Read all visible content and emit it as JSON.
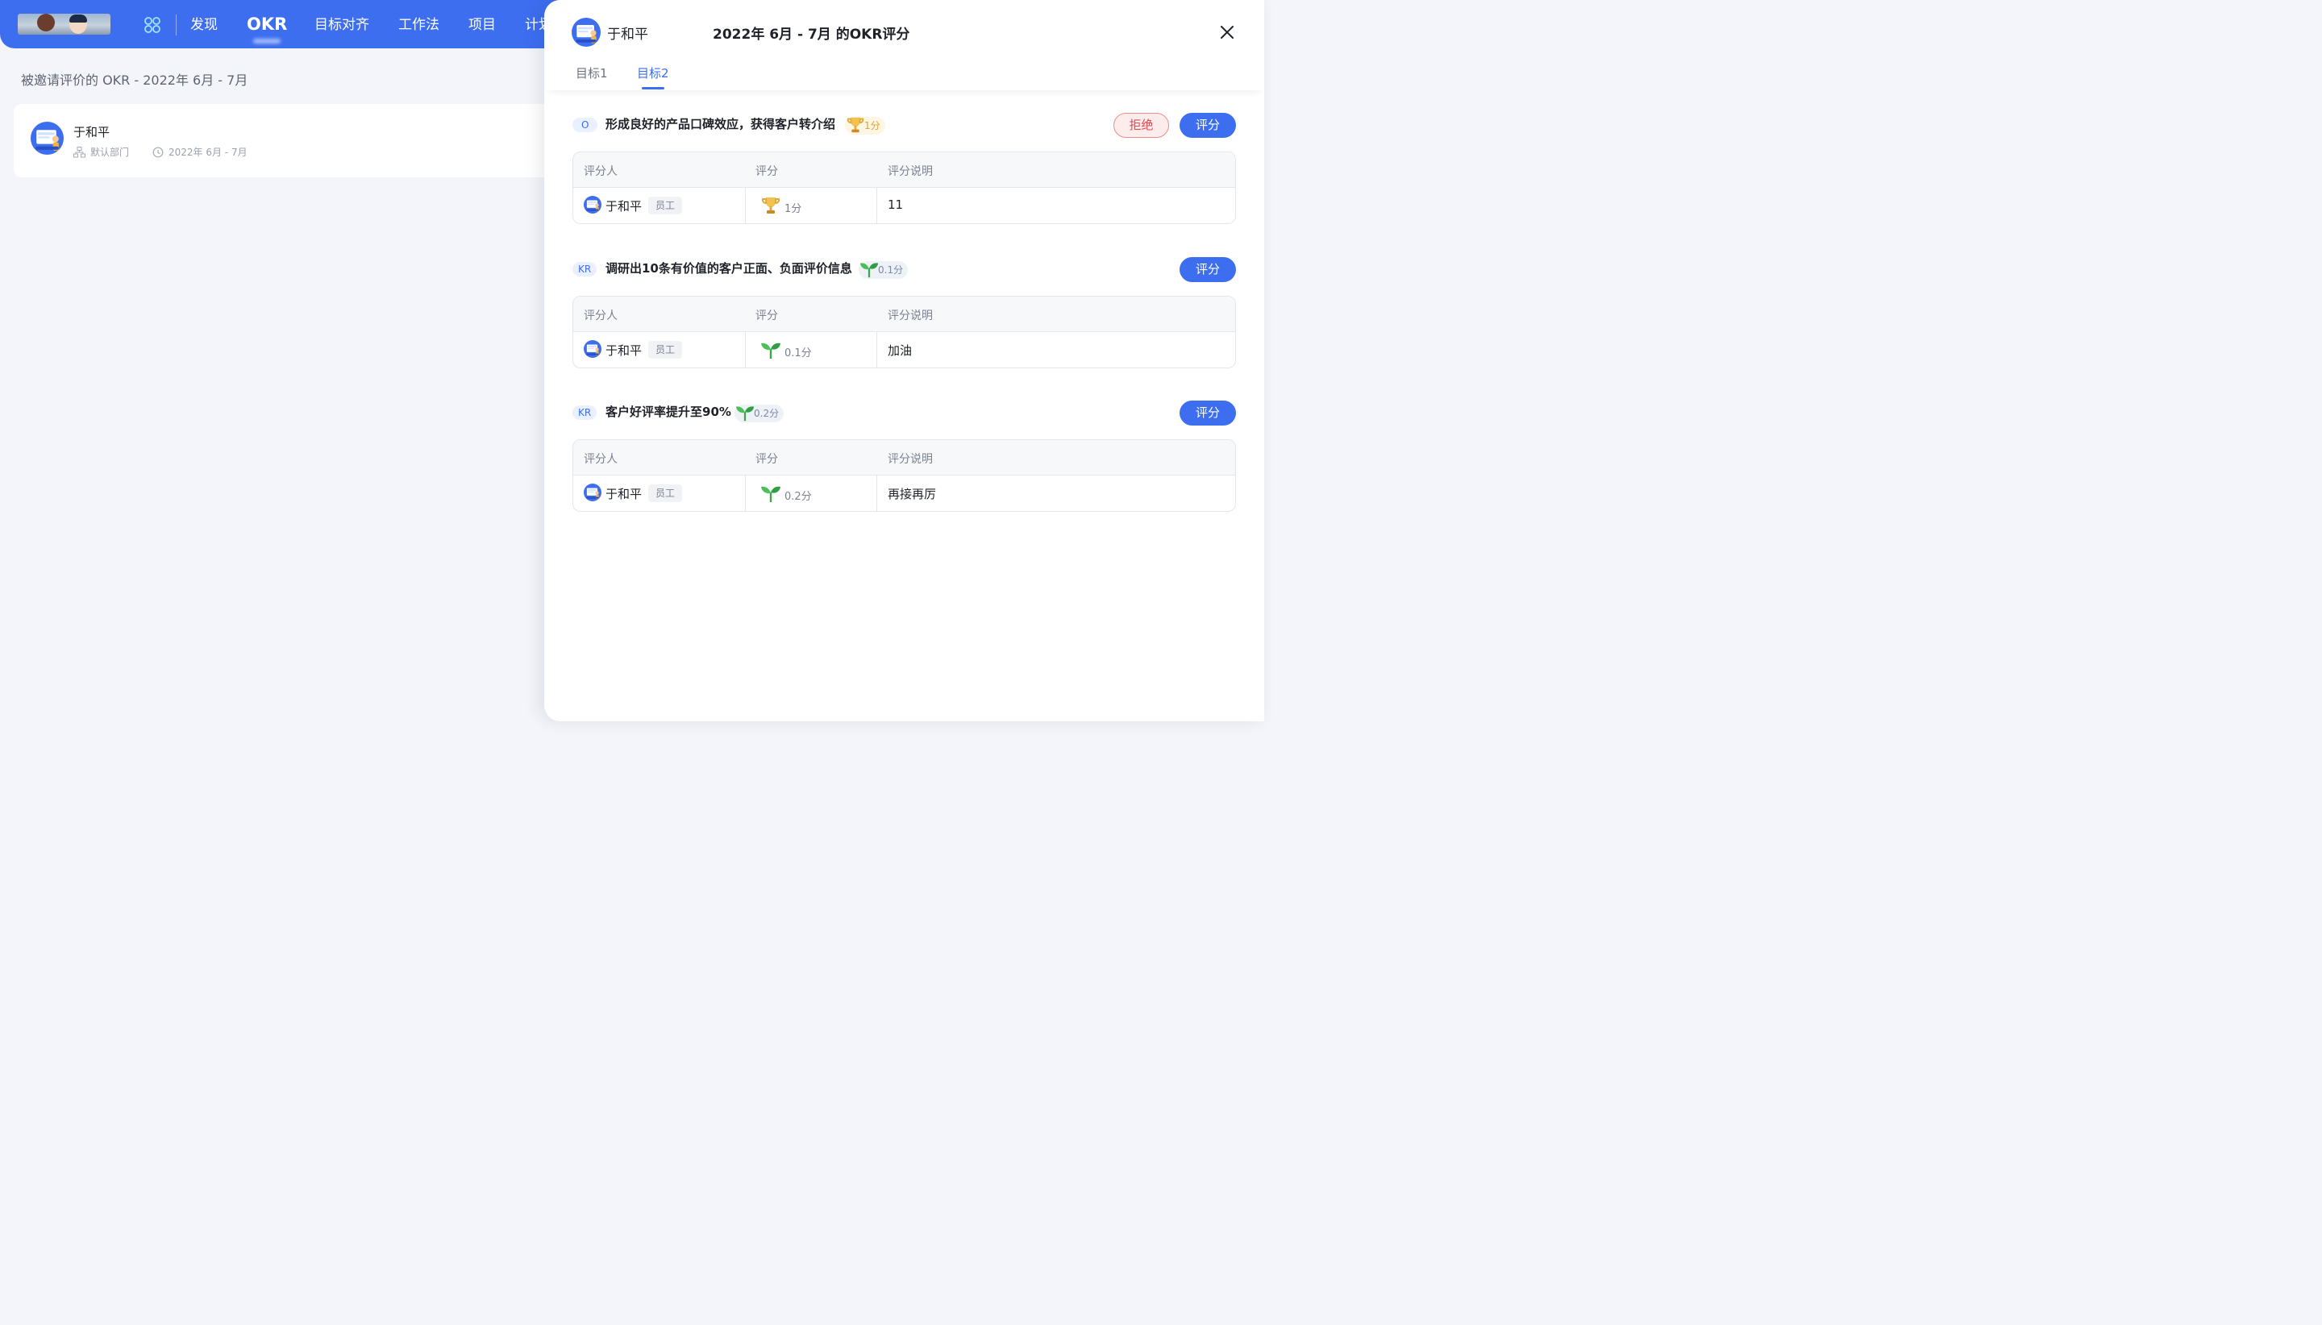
{
  "nav": {
    "items": [
      "发现",
      "OKR",
      "目标对齐",
      "工作法",
      "项目",
      "计划"
    ],
    "active": "OKR"
  },
  "page": {
    "title": "被邀请评价的 OKR - 2022年 6月 - 7月",
    "card": {
      "name": "于和平",
      "department": "默认部门",
      "period": "2022年 6月 - 7月"
    }
  },
  "drawer": {
    "user": "于和平",
    "title": "2022年 6月 - 7月 的OKR评分",
    "tabs": [
      "目标1",
      "目标2"
    ],
    "active_tab": "目标2",
    "table_headers": {
      "rater": "评分人",
      "score": "评分",
      "comment": "评分说明"
    },
    "sections": [
      {
        "tag": "O",
        "text": "形成良好的产品口碑效应，获得客户转介绍",
        "score_badge": "1分",
        "badge_icon": "trophy-icon",
        "has_reject": true,
        "reject_label": "拒绝",
        "score_label": "评分",
        "row": {
          "rater": "于和平",
          "role": "员工",
          "score": "1分",
          "icon": "trophy-icon",
          "comment": "11"
        }
      },
      {
        "tag": "KR",
        "text": "调研出10条有价值的客户正面、负面评价信息",
        "score_badge": "0.1分",
        "badge_icon": "sprout-icon",
        "has_reject": false,
        "score_label": "评分",
        "row": {
          "rater": "于和平",
          "role": "员工",
          "score": "0.1分",
          "icon": "sprout-icon",
          "comment": "加油"
        }
      },
      {
        "tag": "KR",
        "text": "客户好评率提升至90%",
        "score_badge": "0.2分",
        "badge_icon": "sprout-icon",
        "has_reject": false,
        "score_label": "评分",
        "row": {
          "rater": "于和平",
          "role": "员工",
          "score": "0.2分",
          "icon": "sprout-icon",
          "comment": "再接再厉"
        }
      }
    ]
  },
  "colors": {
    "primary": "#3d6ef0",
    "danger": "#e5484d",
    "gold": "#d6a33c",
    "green": "#3aa84a"
  }
}
